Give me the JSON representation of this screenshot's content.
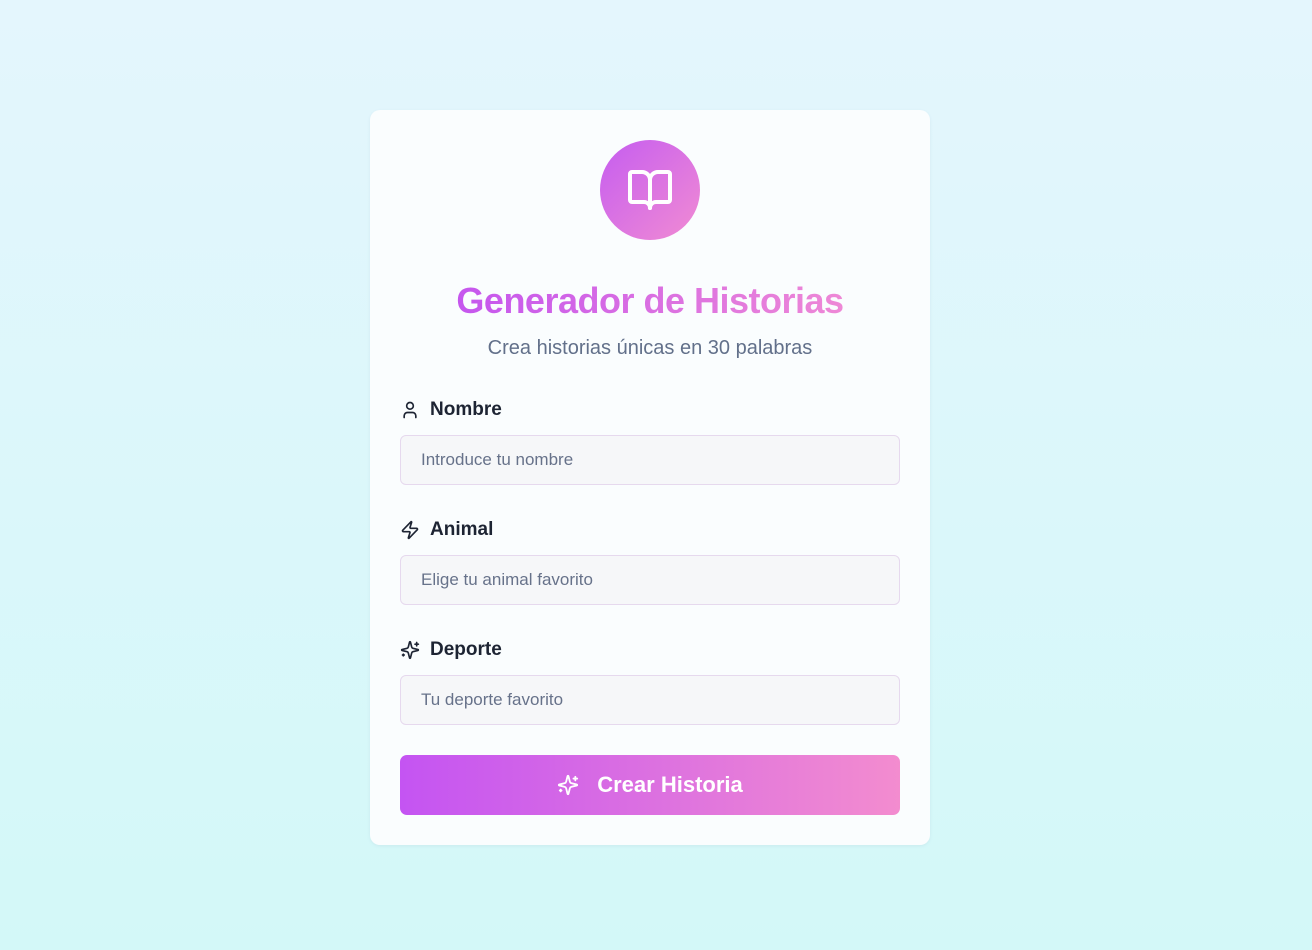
{
  "app": {
    "title": "Generador de Historias",
    "subtitle": "Crea historias únicas en 30 palabras",
    "logo_icon": "book-open-icon"
  },
  "form": {
    "fields": [
      {
        "label": "Nombre",
        "icon": "user-icon",
        "placeholder": "Introduce tu nombre",
        "value": ""
      },
      {
        "label": "Animal",
        "icon": "zap-icon",
        "placeholder": "Elige tu animal favorito",
        "value": ""
      },
      {
        "label": "Deporte",
        "icon": "sparkles-icon",
        "placeholder": "Tu deporte favorito",
        "value": ""
      }
    ],
    "submit_label": "Crear Historia",
    "submit_icon": "sparkles-icon"
  },
  "colors": {
    "gradient_start": "#c454f2",
    "gradient_end": "#f38ccf",
    "background_top": "#e4f6fd",
    "background_bottom": "#d3f8f8",
    "label_text": "#1d2433",
    "muted_text": "#62708a"
  }
}
